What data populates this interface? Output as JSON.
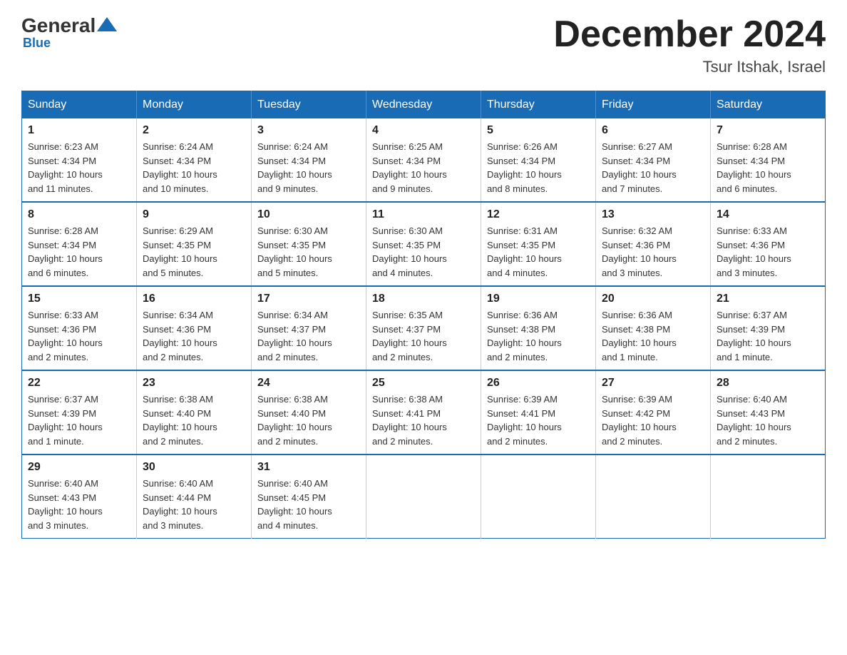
{
  "logo": {
    "general": "General",
    "blue": "Blue",
    "tagline": "Blue"
  },
  "header": {
    "month_year": "December 2024",
    "location": "Tsur Itshak, Israel"
  },
  "weekdays": [
    "Sunday",
    "Monday",
    "Tuesday",
    "Wednesday",
    "Thursday",
    "Friday",
    "Saturday"
  ],
  "weeks": [
    [
      {
        "day": "1",
        "sunrise": "6:23 AM",
        "sunset": "4:34 PM",
        "daylight": "10 hours and 11 minutes."
      },
      {
        "day": "2",
        "sunrise": "6:24 AM",
        "sunset": "4:34 PM",
        "daylight": "10 hours and 10 minutes."
      },
      {
        "day": "3",
        "sunrise": "6:24 AM",
        "sunset": "4:34 PM",
        "daylight": "10 hours and 9 minutes."
      },
      {
        "day": "4",
        "sunrise": "6:25 AM",
        "sunset": "4:34 PM",
        "daylight": "10 hours and 9 minutes."
      },
      {
        "day": "5",
        "sunrise": "6:26 AM",
        "sunset": "4:34 PM",
        "daylight": "10 hours and 8 minutes."
      },
      {
        "day": "6",
        "sunrise": "6:27 AM",
        "sunset": "4:34 PM",
        "daylight": "10 hours and 7 minutes."
      },
      {
        "day": "7",
        "sunrise": "6:28 AM",
        "sunset": "4:34 PM",
        "daylight": "10 hours and 6 minutes."
      }
    ],
    [
      {
        "day": "8",
        "sunrise": "6:28 AM",
        "sunset": "4:34 PM",
        "daylight": "10 hours and 6 minutes."
      },
      {
        "day": "9",
        "sunrise": "6:29 AM",
        "sunset": "4:35 PM",
        "daylight": "10 hours and 5 minutes."
      },
      {
        "day": "10",
        "sunrise": "6:30 AM",
        "sunset": "4:35 PM",
        "daylight": "10 hours and 5 minutes."
      },
      {
        "day": "11",
        "sunrise": "6:30 AM",
        "sunset": "4:35 PM",
        "daylight": "10 hours and 4 minutes."
      },
      {
        "day": "12",
        "sunrise": "6:31 AM",
        "sunset": "4:35 PM",
        "daylight": "10 hours and 4 minutes."
      },
      {
        "day": "13",
        "sunrise": "6:32 AM",
        "sunset": "4:36 PM",
        "daylight": "10 hours and 3 minutes."
      },
      {
        "day": "14",
        "sunrise": "6:33 AM",
        "sunset": "4:36 PM",
        "daylight": "10 hours and 3 minutes."
      }
    ],
    [
      {
        "day": "15",
        "sunrise": "6:33 AM",
        "sunset": "4:36 PM",
        "daylight": "10 hours and 2 minutes."
      },
      {
        "day": "16",
        "sunrise": "6:34 AM",
        "sunset": "4:36 PM",
        "daylight": "10 hours and 2 minutes."
      },
      {
        "day": "17",
        "sunrise": "6:34 AM",
        "sunset": "4:37 PM",
        "daylight": "10 hours and 2 minutes."
      },
      {
        "day": "18",
        "sunrise": "6:35 AM",
        "sunset": "4:37 PM",
        "daylight": "10 hours and 2 minutes."
      },
      {
        "day": "19",
        "sunrise": "6:36 AM",
        "sunset": "4:38 PM",
        "daylight": "10 hours and 2 minutes."
      },
      {
        "day": "20",
        "sunrise": "6:36 AM",
        "sunset": "4:38 PM",
        "daylight": "10 hours and 1 minute."
      },
      {
        "day": "21",
        "sunrise": "6:37 AM",
        "sunset": "4:39 PM",
        "daylight": "10 hours and 1 minute."
      }
    ],
    [
      {
        "day": "22",
        "sunrise": "6:37 AM",
        "sunset": "4:39 PM",
        "daylight": "10 hours and 1 minute."
      },
      {
        "day": "23",
        "sunrise": "6:38 AM",
        "sunset": "4:40 PM",
        "daylight": "10 hours and 2 minutes."
      },
      {
        "day": "24",
        "sunrise": "6:38 AM",
        "sunset": "4:40 PM",
        "daylight": "10 hours and 2 minutes."
      },
      {
        "day": "25",
        "sunrise": "6:38 AM",
        "sunset": "4:41 PM",
        "daylight": "10 hours and 2 minutes."
      },
      {
        "day": "26",
        "sunrise": "6:39 AM",
        "sunset": "4:41 PM",
        "daylight": "10 hours and 2 minutes."
      },
      {
        "day": "27",
        "sunrise": "6:39 AM",
        "sunset": "4:42 PM",
        "daylight": "10 hours and 2 minutes."
      },
      {
        "day": "28",
        "sunrise": "6:40 AM",
        "sunset": "4:43 PM",
        "daylight": "10 hours and 2 minutes."
      }
    ],
    [
      {
        "day": "29",
        "sunrise": "6:40 AM",
        "sunset": "4:43 PM",
        "daylight": "10 hours and 3 minutes."
      },
      {
        "day": "30",
        "sunrise": "6:40 AM",
        "sunset": "4:44 PM",
        "daylight": "10 hours and 3 minutes."
      },
      {
        "day": "31",
        "sunrise": "6:40 AM",
        "sunset": "4:45 PM",
        "daylight": "10 hours and 4 minutes."
      },
      null,
      null,
      null,
      null
    ]
  ],
  "labels": {
    "sunrise": "Sunrise:",
    "sunset": "Sunset:",
    "daylight": "Daylight:"
  }
}
